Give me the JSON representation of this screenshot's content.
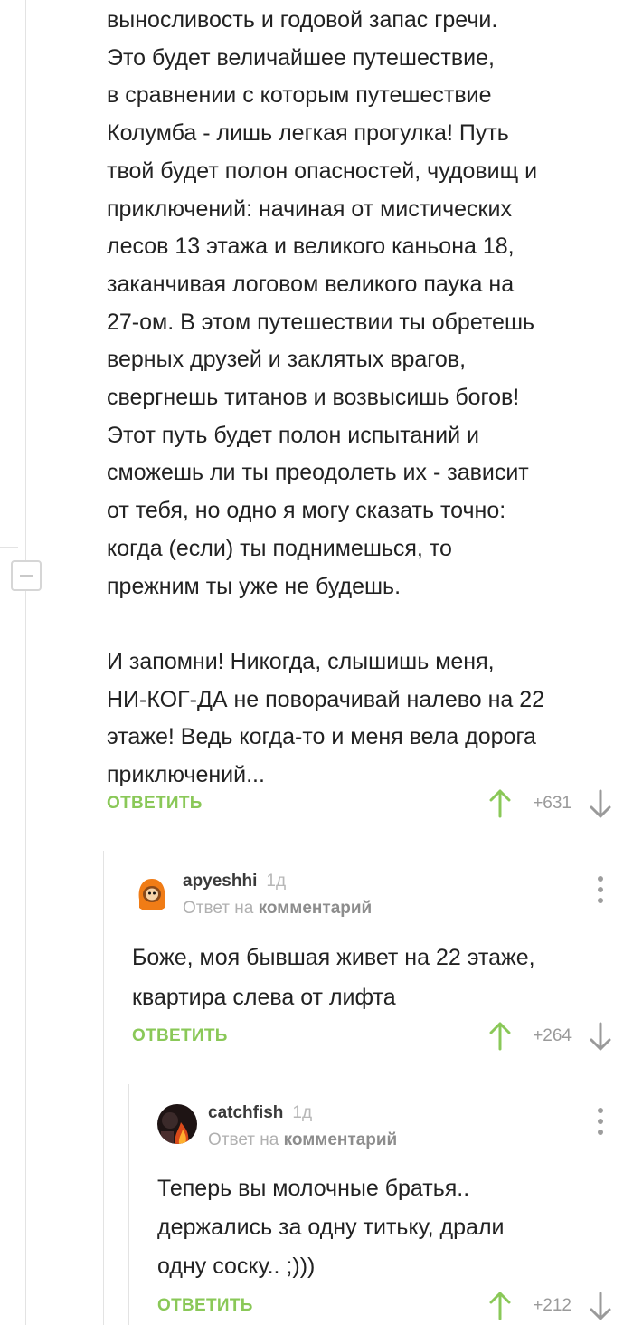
{
  "main_comment": {
    "body": "выносливость и годовой запас гречи.\nЭто будет величайшее путешествие,\nв сравнении с которым путешествие\nКолумба - лишь легкая прогулка! Путь\nтвой будет полон опасностей, чудовищ и\nприключений: начиная от мистических\nлесов 13 этажа и великого каньона 18,\nзаканчивая логовом великого паука на\n27-ом. В этом путешествии ты обретешь\nверных друзей и заклятых врагов,\nсвергнешь титанов и возвысишь богов!\nЭтот путь будет полон испытаний и\nсможешь ли ты преодолеть их - зависит\nот тебя, но одно я могу сказать точно:\nкогда (если) ты поднимешься, то\nпрежним ты уже не будешь.\n\nИ запомни! Никогда, слышишь меня,\nНИ-КОГ-ДА не поворачивай налево на 22\nэтаже! Ведь когда-то и меня вела дорога\nприключений...",
    "reply_label": "ОТВЕТИТЬ",
    "score": "+631"
  },
  "replies": [
    {
      "author": "apyeshhi",
      "time": "1д",
      "reply_prefix": "Ответ на",
      "reply_target": "комментарий",
      "body": "Боже, моя бывшая живет на 22 этаже,\nквартира слева от лифта",
      "reply_label": "ОТВЕТИТЬ",
      "score": "+264",
      "avatar_icon": "kenny-avatar"
    },
    {
      "author": "catchfish",
      "time": "1д",
      "reply_prefix": "Ответ на",
      "reply_target": "комментарий",
      "body": "Теперь вы молочные братья..\nдержались за одну титьку, драли\nодну соску.. ;)))",
      "reply_label": "ОТВЕТИТЬ",
      "score": "+212",
      "avatar_icon": "fire-photo-avatar"
    }
  ],
  "colors": {
    "accent_green": "#8ac858",
    "downvote_gray": "#9a9a9a",
    "thread_line": "#e3e3e3"
  }
}
